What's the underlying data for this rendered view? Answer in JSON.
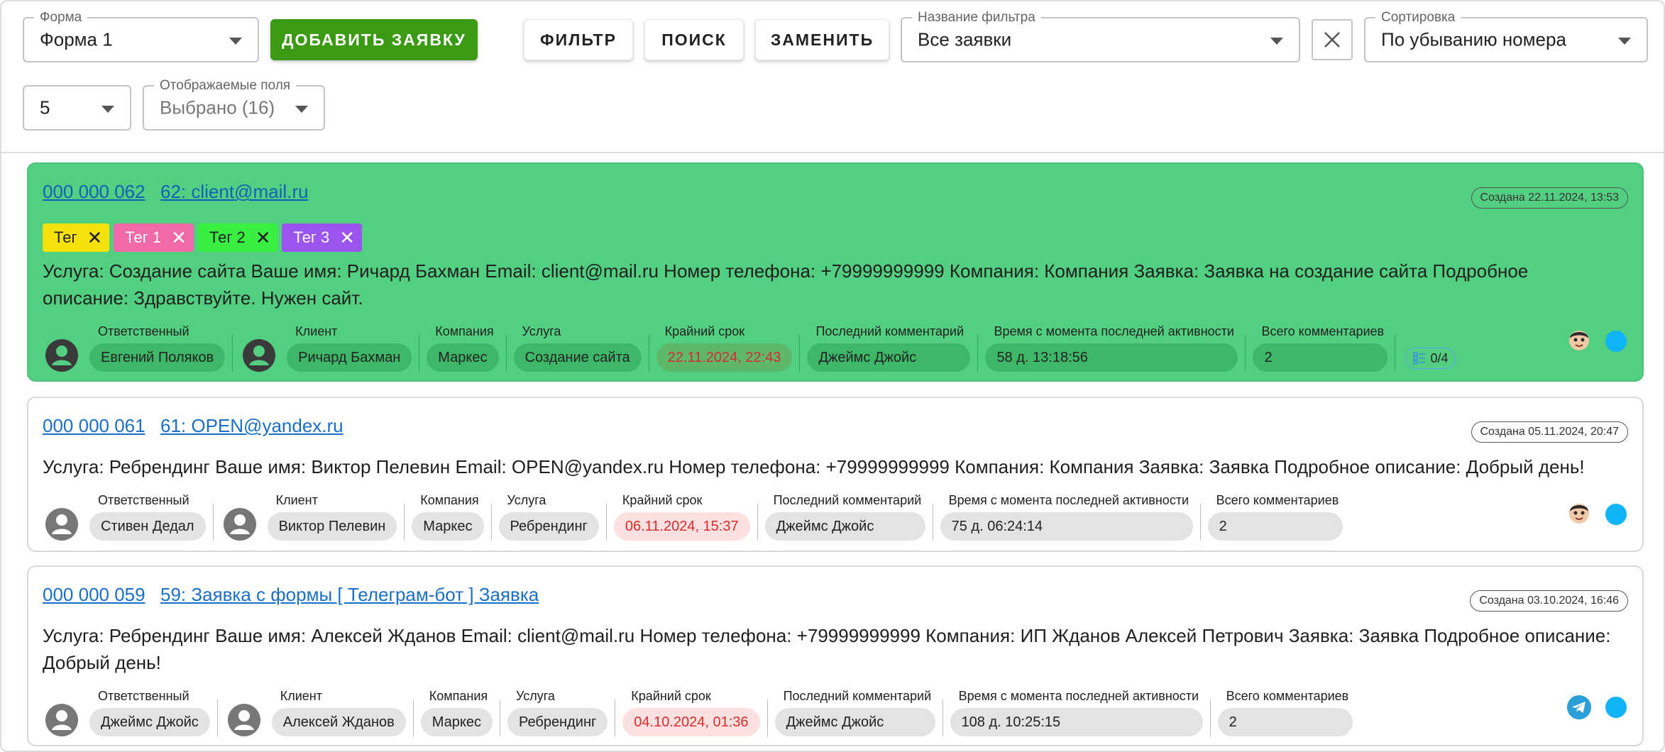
{
  "toolbar": {
    "form": {
      "label": "Форма",
      "value": "Форма 1"
    },
    "add_button": "Добавить заявку",
    "filter_button": "Фильтр",
    "search_button": "Поиск",
    "replace_button": "Заменить",
    "filter_name": {
      "label": "Название фильтра",
      "value": "Все заявки"
    },
    "sort": {
      "label": "Сортировка",
      "value": "По убыванию номера"
    },
    "page_size": {
      "value": "5"
    },
    "fields": {
      "label": "Отображаемые поля",
      "value": "Выбрано (16)"
    }
  },
  "labels": {
    "responsible": "Ответственный",
    "client": "Клиент",
    "company": "Компания",
    "service": "Услуга",
    "deadline": "Крайний срок",
    "last_comment": "Последний комментарий",
    "since_activity": "Время с момента последней активности",
    "total_comments": "Всего комментариев"
  },
  "tickets": [
    {
      "number": "000 000 062",
      "title": "62: client@mail.ru",
      "created": "Создана 22.11.2024, 13:53",
      "highlight_color": "#52cf80",
      "tags": [
        {
          "label": "Тег",
          "color": "#f5e20a",
          "text_color": "#1f1f1f"
        },
        {
          "label": "Тег 1",
          "color": "#f06aa8",
          "text_color": "#ffffff"
        },
        {
          "label": "Тег 2",
          "color": "#39f042",
          "text_color": "#1f1f1f"
        },
        {
          "label": "Тег 3",
          "color": "#9a55f0",
          "text_color": "#ffffff"
        }
      ],
      "description": "Услуга: Создание сайта Ваше имя: Ричард Бахман Email: client@mail.ru Номер телефона: +79999999999 Компания: Компания Заявка: Заявка на создание сайта Подробное описание: Здравствуйте. Нужен сайт.",
      "responsible": "Евгений Поляков",
      "client": "Ричард Бахман",
      "company": "Маркес",
      "service": "Создание сайта",
      "deadline": "22.11.2024, 22:43",
      "last_comment": "Джеймс Джойс",
      "since_activity": "58 д. 13:18:56",
      "total_comments": "2",
      "checklist": "0/4",
      "source_icon": "avatar-face-icon"
    },
    {
      "number": "000 000 061",
      "title": "61: OPEN@yandex.ru",
      "created": "Создана 05.11.2024, 20:47",
      "description": "Услуга: Ребрендинг Ваше имя: Виктор Пелевин Email: OPEN@yandex.ru Номер телефона: +79999999999 Компания: Компания Заявка: Заявка Подробное описание: Добрый день!",
      "responsible": "Стивен Дедал",
      "client": "Виктор Пелевин",
      "company": "Маркес",
      "service": "Ребрендинг",
      "deadline": "06.11.2024, 15:37",
      "last_comment": "Джеймс Джойс",
      "since_activity": "75 д. 06:24:14",
      "total_comments": "2",
      "source_icon": "avatar-face-icon"
    },
    {
      "number": "000 000 059",
      "title": "59: Заявка с формы [ Телеграм-бот ] Заявка",
      "created": "Создана 03.10.2024, 16:46",
      "description": "Услуга: Ребрендинг Ваше имя: Алексей Жданов Email: client@mail.ru Номер телефона: +79999999999 Компания: ИП Жданов Алексей Петрович Заявка: Заявка Подробное описание: Добрый день!",
      "responsible": "Джеймс Джойс",
      "client": "Алексей Жданов",
      "company": "Маркес",
      "service": "Ребрендинг",
      "deadline": "04.10.2024, 01:36",
      "last_comment": "Джеймс Джойс",
      "since_activity": "108 д. 10:25:15",
      "total_comments": "2",
      "source_icon": "telegram-icon"
    }
  ],
  "colors": {
    "accent_green": "#3a9a13",
    "link": "#1a6fc9",
    "deadline_red": "#e02a2a",
    "status_dot": "#10b4f6"
  }
}
